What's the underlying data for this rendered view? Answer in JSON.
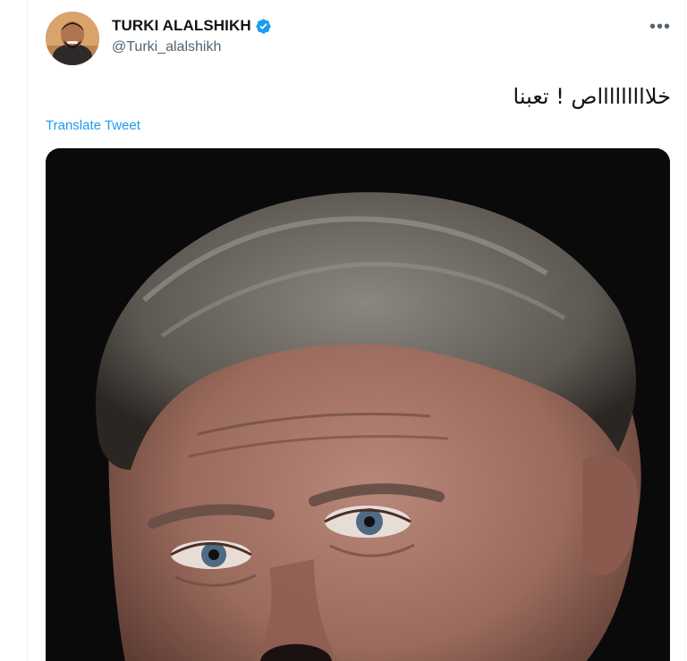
{
  "tweet": {
    "author": {
      "display_name": "TURKI ALALSHIKH",
      "handle": "@Turki_alalshikh",
      "verified": true
    },
    "text": "خلاااااااااص ! تعبنا",
    "translate_label": "Translate Tweet",
    "more_icon": "more-horizontal-icon"
  },
  "colors": {
    "accent": "#1d9bf0",
    "text_primary": "#0f1419",
    "text_secondary": "#536471"
  }
}
